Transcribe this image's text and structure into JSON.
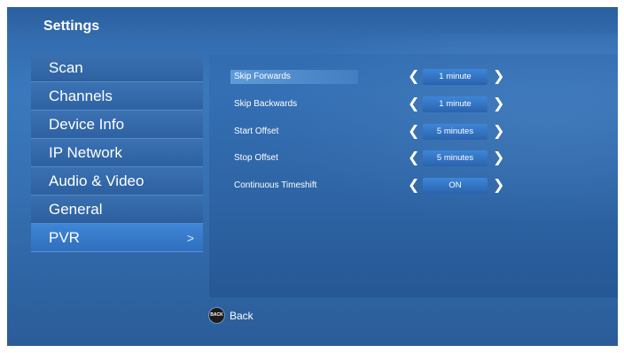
{
  "page_title": "Settings",
  "sidebar": {
    "items": [
      {
        "label": "Scan"
      },
      {
        "label": "Channels"
      },
      {
        "label": "Device Info"
      },
      {
        "label": "IP Network"
      },
      {
        "label": "Audio & Video"
      },
      {
        "label": "General"
      },
      {
        "label": "PVR",
        "active": true,
        "arrow": ">"
      }
    ]
  },
  "settings": {
    "rows": [
      {
        "label": "Skip Forwards",
        "value": "1 minute",
        "highlighted": true
      },
      {
        "label": "Skip Backwards",
        "value": "1 minute"
      },
      {
        "label": "Start Offset",
        "value": "5 minutes"
      },
      {
        "label": "Stop Offset",
        "value": "5 minutes"
      },
      {
        "label": "Continuous Timeshift",
        "value": "ON"
      }
    ],
    "left_arrow": "❮",
    "right_arrow": "❯"
  },
  "footer": {
    "back_icon_text": "BACK",
    "back_label": "Back"
  },
  "colors": {
    "background": "#3570b2",
    "selected_item": "#3f86d6",
    "value_box": "#2f6fbe",
    "text": "#ffffff"
  }
}
